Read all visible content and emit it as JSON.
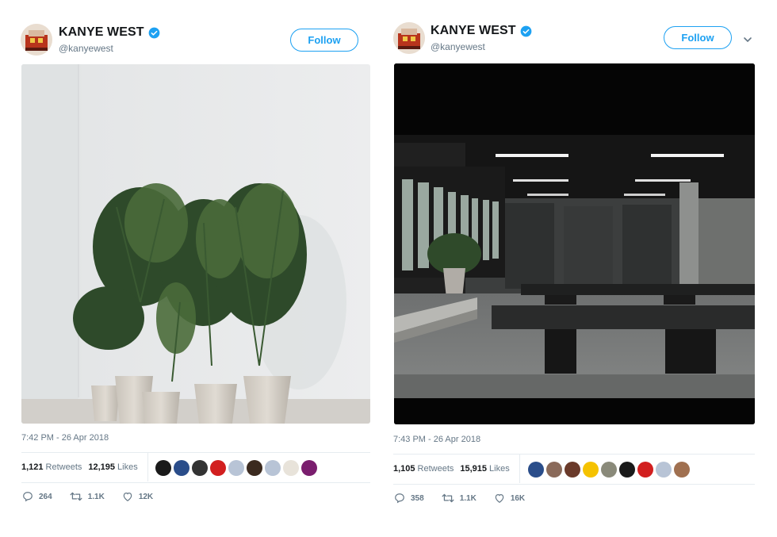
{
  "tweets": [
    {
      "author_name": "KANYE WEST",
      "handle": "@kanyewest",
      "follow_label": "Follow",
      "timestamp": "7:42 PM - 26 Apr 2018",
      "retweets_count": "1,121",
      "retweets_label": "Retweets",
      "likes_count": "12,195",
      "likes_label": "Likes",
      "replies": "264",
      "retweets_short": "1.1K",
      "likes_short": "12K",
      "photo_description": "potted palm plants against white wall",
      "liker_colors": [
        "#1a1a1a",
        "#2a4d8a",
        "#333333",
        "#d21f1f",
        "#b8c4d6",
        "#3b2a1f",
        "#b8c4d6",
        "#e8e3da",
        "#7a1e6e"
      ]
    },
    {
      "author_name": "KANYE WEST",
      "handle": "@kanyewest",
      "follow_label": "Follow",
      "timestamp": "7:43 PM - 26 Apr 2018",
      "retweets_count": "1,105",
      "retweets_label": "Retweets",
      "likes_count": "15,915",
      "likes_label": "Likes",
      "replies": "358",
      "retweets_short": "1.1K",
      "likes_short": "16K",
      "photo_description": "dark concrete studio interior with tables",
      "liker_colors": [
        "#2a4d8a",
        "#8a6a5a",
        "#6a3a2a",
        "#f5c200",
        "#8a8a7a",
        "#1a1a1a",
        "#d21f1f",
        "#b8c4d6",
        "#a07050"
      ]
    }
  ],
  "colors": {
    "brand_blue": "#1da1f2",
    "text_primary": "#14171a",
    "text_secondary": "#657786",
    "divider": "#e6ecf0"
  }
}
